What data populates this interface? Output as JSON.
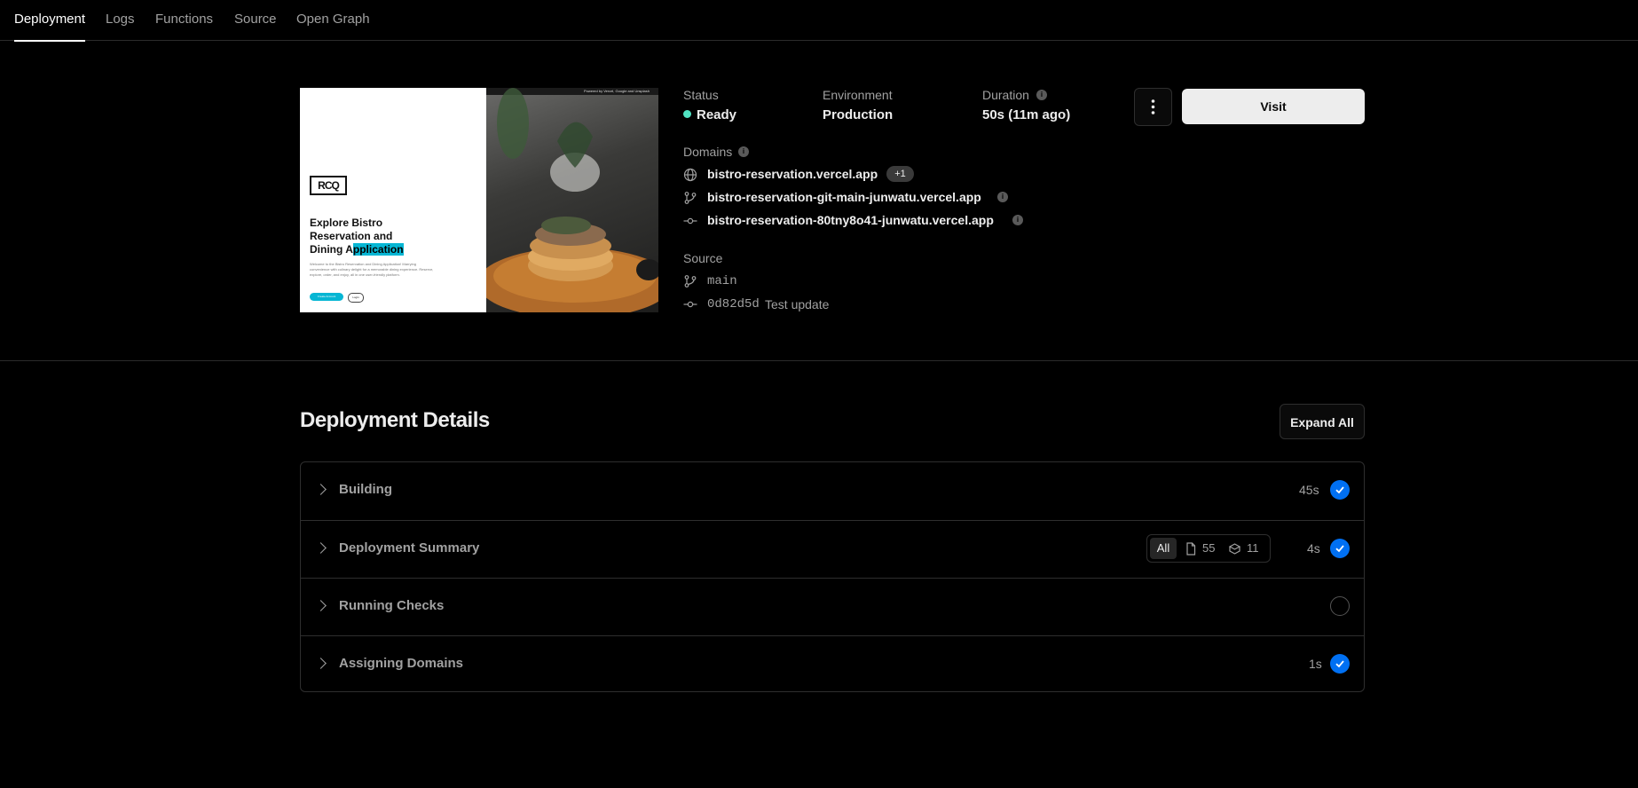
{
  "tabs": [
    "Deployment",
    "Logs",
    "Functions",
    "Source",
    "Open Graph"
  ],
  "preview": {
    "logo_text": "RCQ",
    "hero_line1": "Explore Bistro",
    "hero_line2": "Reservation and",
    "hero_line3_plain": "Dining A",
    "hero_line3_highlight": "pplication",
    "hero_body": "Welcome to the Bistro Reservation and Dining Application! Marrying convenience with culinary delight for a memorable dining experience. Reserve, explore, order, and enjoy, all in one user-friendly platform.",
    "btn_primary": "Create Account",
    "btn_secondary": "Login",
    "topbar_text": "Powered by Vercel, Google and Unsplash"
  },
  "status": {
    "label": "Status",
    "value": "Ready",
    "color": "#50e3c2"
  },
  "environment": {
    "label": "Environment",
    "value": "Production"
  },
  "duration": {
    "label": "Duration",
    "value": "50s (11m ago)"
  },
  "domains": {
    "label": "Domains",
    "items": [
      "bistro-reservation.vercel.app",
      "bistro-reservation-git-main-junwatu.vercel.app",
      "bistro-reservation-80tny8o41-junwatu.vercel.app"
    ],
    "extra_count": "+1"
  },
  "source": {
    "label": "Source",
    "branch": "main",
    "commit_hash": "0d82d5d",
    "commit_message": "Test update"
  },
  "actions": {
    "visit": "Visit"
  },
  "details": {
    "title": "Deployment Details",
    "expand_all": "Expand All",
    "rows": [
      {
        "title": "Building",
        "time": "45s",
        "status": "done"
      },
      {
        "title": "Deployment Summary",
        "time": "4s",
        "status": "done"
      },
      {
        "title": "Running Checks",
        "time": "",
        "status": "pending"
      },
      {
        "title": "Assigning Domains",
        "time": "1s",
        "status": "done"
      }
    ],
    "summary_filter": {
      "all": "All",
      "files": "55",
      "functions": "11"
    }
  },
  "colors": {
    "accent": "#0070f3",
    "ready": "#50e3c2"
  }
}
